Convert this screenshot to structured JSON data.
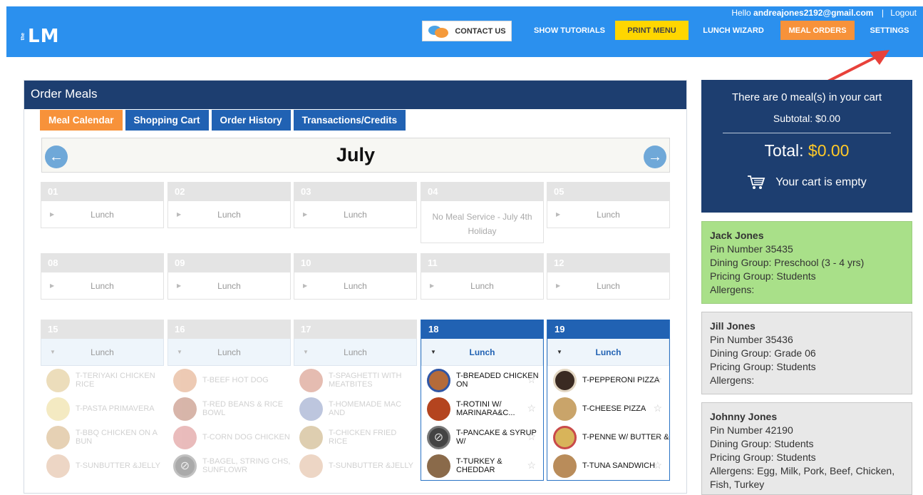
{
  "header": {
    "logo_small": "the",
    "logo": "LM",
    "greeting_prefix": "Hello",
    "email": "andreajones2192@gmail.com",
    "separator": "|",
    "logout": "Logout",
    "nav": {
      "contact": "CONTACT US",
      "tutorials": "SHOW TUTORIALS",
      "print": "PRINT MENU",
      "wizard": "LUNCH WIZARD",
      "orders": "MEAL ORDERS",
      "settings": "SETTINGS"
    }
  },
  "panel": {
    "title": "Order Meals",
    "tabs": [
      "Meal Calendar",
      "Shopping Cart",
      "Order History",
      "Transactions/Credits"
    ],
    "month": "July"
  },
  "calendar": {
    "lunch": "Lunch",
    "row1": [
      {
        "date": "01"
      },
      {
        "date": "02"
      },
      {
        "date": "03"
      },
      {
        "date": "04",
        "note": "No Meal Service - July 4th Holiday"
      },
      {
        "date": "05"
      }
    ],
    "row2": [
      {
        "date": "08"
      },
      {
        "date": "09"
      },
      {
        "date": "10"
      },
      {
        "date": "11"
      },
      {
        "date": "12"
      }
    ],
    "row3": [
      {
        "date": "15",
        "items": [
          "T-TERIYAKI CHICKEN RICE",
          "T-PASTA PRIMAVERA",
          "T-BBQ CHICKEN ON A BUN",
          "T-SUNBUTTER &JELLY"
        ]
      },
      {
        "date": "16",
        "items": [
          "T-BEEF HOT DOG",
          "T-RED BEANS & RICE BOWL",
          "T-CORN DOG CHICKEN",
          "T-BAGEL, STRING CHS, SUNFLOWR"
        ]
      },
      {
        "date": "17",
        "items": [
          "T-SPAGHETTI WITH MEATBITES",
          "T-HOMEMADE MAC AND",
          "T-CHICKEN FRIED RICE",
          "T-SUNBUTTER &JELLY"
        ]
      },
      {
        "date": "18",
        "items": [
          "T-BREADED CHICKEN ON",
          "T-ROTINI W/ MARINARA&C...",
          "T-PANCAKE & SYRUP W/",
          "T-TURKEY & CHEDDAR"
        ]
      },
      {
        "date": "19",
        "items": [
          "T-PEPPERONI PIZZA",
          "T-CHEESE PIZZA",
          "T-PENNE W/ BUTTER &",
          "T-TUNA SANDWICH"
        ]
      }
    ]
  },
  "cart": {
    "count_text": "There are 0 meal(s) in your cart",
    "subtotal_text": "Subtotal:  $0.00",
    "total_label": "Total:",
    "total_amount": "$0.00",
    "empty_text": "Your cart is empty",
    "accent_color": "#ffc928"
  },
  "students": [
    {
      "name": "Jack Jones",
      "pin": "Pin Number 35435",
      "dining": "Dining Group: Preschool (3 - 4 yrs)",
      "pricing": "Pricing Group: Students",
      "allergens": "Allergens:"
    },
    {
      "name": "Jill Jones",
      "pin": "Pin Number 35436",
      "dining": "Dining Group: Grade 06",
      "pricing": "Pricing Group: Students",
      "allergens": "Allergens:"
    },
    {
      "name": "Johnny Jones",
      "pin": "Pin Number 42190",
      "dining": "Dining Group: Students",
      "pricing": "Pricing Group: Students",
      "allergens": "Allergens: Egg, Milk, Pork, Beef, Chicken, Fish, Turkey"
    }
  ],
  "colors": {
    "topbar": "#2b90ee",
    "navy": "#1d3e70",
    "tab_blue": "#2162b3",
    "orange": "#f7923a",
    "yellow": "#ffd600",
    "green_card": "#a9e089"
  }
}
